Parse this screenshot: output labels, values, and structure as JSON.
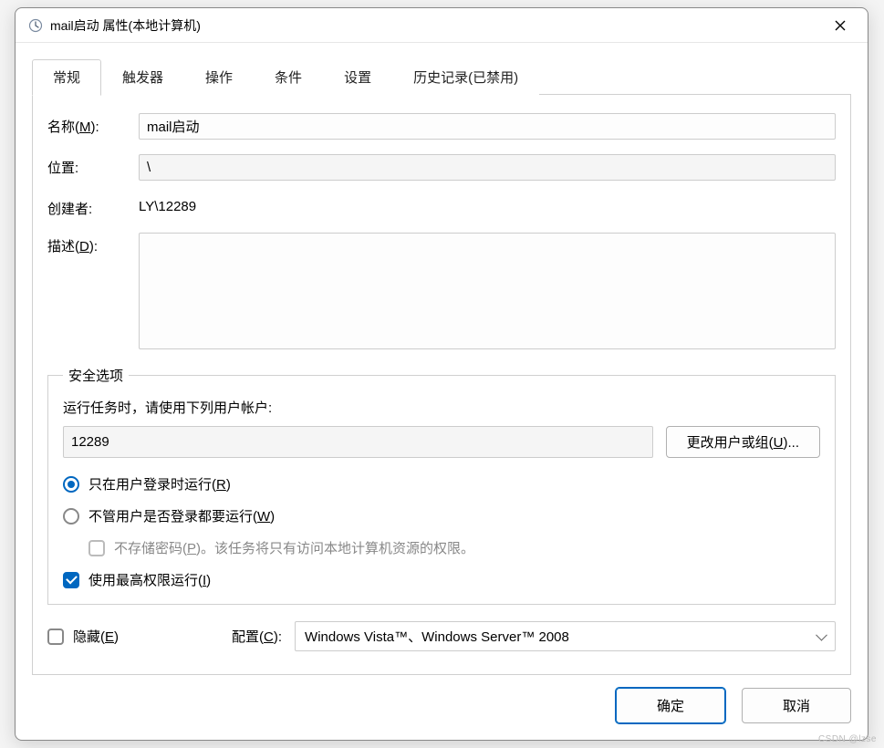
{
  "window": {
    "title": "mail启动 属性(本地计算机)"
  },
  "tabs": [
    {
      "label": "常规",
      "active": true
    },
    {
      "label": "触发器",
      "active": false
    },
    {
      "label": "操作",
      "active": false
    },
    {
      "label": "条件",
      "active": false
    },
    {
      "label": "设置",
      "active": false
    },
    {
      "label": "历史记录(已禁用)",
      "active": false
    }
  ],
  "general": {
    "name_label": "名称(M):",
    "name_value": "mail启动",
    "location_label": "位置:",
    "location_value": "\\",
    "author_label": "创建者:",
    "author_value": "LY\\12289",
    "description_label": "描述(D):",
    "description_value": ""
  },
  "security": {
    "legend": "安全选项",
    "run_as_label": "运行任务时，请使用下列用户帐户:",
    "user_value": "12289",
    "change_user_btn": "更改用户或组(U)...",
    "run_logged_on_label": "只在用户登录时运行(R)",
    "run_regardless_label": "不管用户是否登录都要运行(W)",
    "no_store_pwd_label": "不存储密码(P)。该任务将只有访问本地计算机资源的权限。",
    "highest_priv_label": "使用最高权限运行(I)",
    "run_logged_on_checked": true,
    "run_regardless_checked": false,
    "no_store_pwd_checked": false,
    "highest_priv_checked": true
  },
  "bottom": {
    "hidden_label": "隐藏(E)",
    "hidden_checked": false,
    "config_label": "配置(C):",
    "config_value": "Windows Vista™、Windows Server™ 2008"
  },
  "footer": {
    "ok": "确定",
    "cancel": "取消"
  },
  "watermark": "CSDN @lzse"
}
